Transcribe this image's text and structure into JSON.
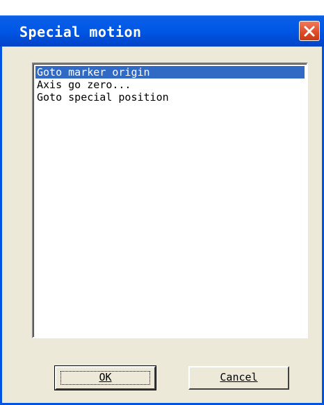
{
  "window": {
    "title": "Special motion"
  },
  "listbox": {
    "items": [
      {
        "label": "Goto marker origin",
        "selected": true
      },
      {
        "label": "Axis go zero...",
        "selected": false
      },
      {
        "label": "Goto special position",
        "selected": false
      }
    ]
  },
  "buttons": {
    "ok_label": "OK",
    "cancel_label": "Cancel"
  },
  "colors": {
    "titlebar": "#0058e6",
    "selection": "#316ac5",
    "close_button": "#de4a25",
    "dialog_bg": "#ece9d8"
  },
  "icons": {
    "close": "close-icon"
  }
}
